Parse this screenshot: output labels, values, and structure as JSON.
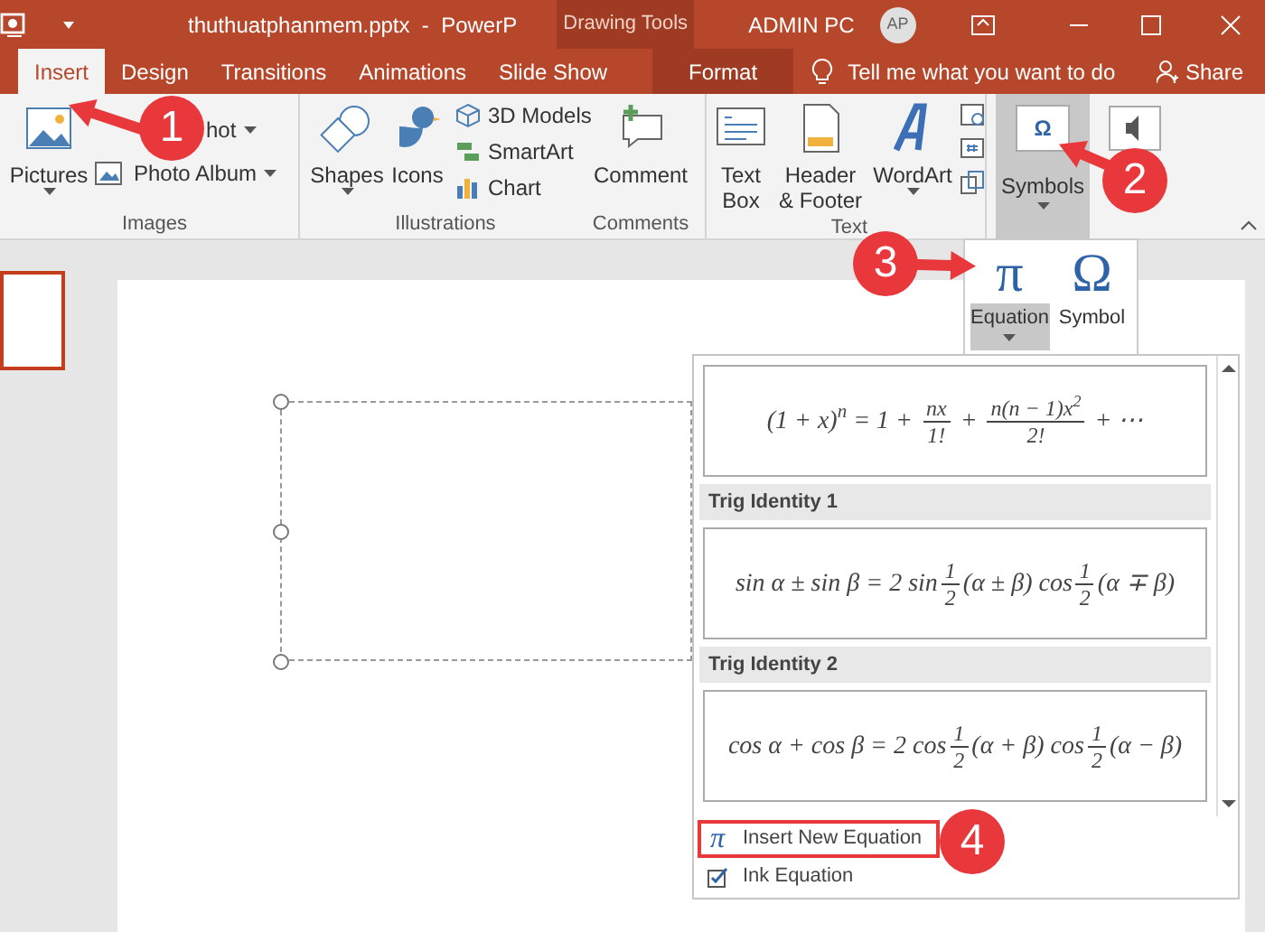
{
  "window": {
    "title": "thuthuatphanmem.pptx  -  PowerP",
    "contextual_group": "Drawing Tools",
    "user": "ADMIN PC",
    "avatar": "AP"
  },
  "tabs": [
    {
      "label": "Insert",
      "selected": true,
      "kind": "normal"
    },
    {
      "label": "Design",
      "selected": false,
      "kind": "normal"
    },
    {
      "label": "Transitions",
      "selected": false,
      "kind": "normal"
    },
    {
      "label": "Animations",
      "selected": false,
      "kind": "normal"
    },
    {
      "label": "Slide Show",
      "selected": false,
      "kind": "normal"
    },
    {
      "label": "Format",
      "selected": false,
      "kind": "contextual"
    }
  ],
  "tell_me": {
    "placeholder": "Tell me what you want to do"
  },
  "share": "Share",
  "ribbon": {
    "groups": [
      {
        "label": "Images",
        "items": [
          "Pictures",
          "hot",
          "Photo Album"
        ]
      },
      {
        "label": "Illustrations",
        "items": [
          "Shapes",
          "Icons",
          "3D Models",
          "SmartArt",
          "Chart"
        ]
      },
      {
        "label": "Comments",
        "items": [
          "Comment"
        ]
      },
      {
        "label": "Text",
        "items": [
          "Text Box",
          "Header & Footer",
          "WordArt"
        ]
      }
    ],
    "symbols": {
      "label": "Symbols",
      "glyph": "Ω",
      "selected": true
    }
  },
  "symbols_menu": [
    {
      "label": "Equation",
      "glyph": "π",
      "selected": true
    },
    {
      "label": "Symbol",
      "glyph": "Ω",
      "selected": false
    }
  ],
  "gallery": {
    "entries": [
      {
        "pieces": [
          {
            "kind": "text",
            "text": "(1 + x)$^{n}$ = 1 + "
          },
          {
            "kind": "frac",
            "num": "nx",
            "den": "1!"
          },
          {
            "kind": "text",
            "text": " + "
          },
          {
            "kind": "frac",
            "num": "n(n − 1)x$^{2}$",
            "den": "2!"
          },
          {
            "kind": "text",
            "text": " + ⋯"
          }
        ]
      },
      {
        "heading": "Trig Identity 1",
        "pieces": [
          {
            "kind": "text",
            "text": "sin α ± sin β = 2 sin"
          },
          {
            "kind": "frac",
            "num": "1",
            "den": "2"
          },
          {
            "kind": "text",
            "text": "(α ± β) cos"
          },
          {
            "kind": "frac",
            "num": "1",
            "den": "2"
          },
          {
            "kind": "text",
            "text": "(α ∓ β)"
          }
        ]
      },
      {
        "heading": "Trig Identity 2",
        "pieces": [
          {
            "kind": "text",
            "text": "cos α + cos β = 2 cos"
          },
          {
            "kind": "frac",
            "num": "1",
            "den": "2"
          },
          {
            "kind": "text",
            "text": "(α + β) cos"
          },
          {
            "kind": "frac",
            "num": "1",
            "den": "2"
          },
          {
            "kind": "text",
            "text": "(α − β)"
          }
        ]
      }
    ],
    "commands": [
      {
        "label": "Insert New Equation",
        "glyph": "π",
        "boxed": true
      },
      {
        "label": "Ink Equation",
        "boxed": false
      }
    ]
  },
  "callouts": [
    {
      "number": "1"
    },
    {
      "number": "2"
    },
    {
      "number": "3"
    },
    {
      "number": "4"
    }
  ]
}
